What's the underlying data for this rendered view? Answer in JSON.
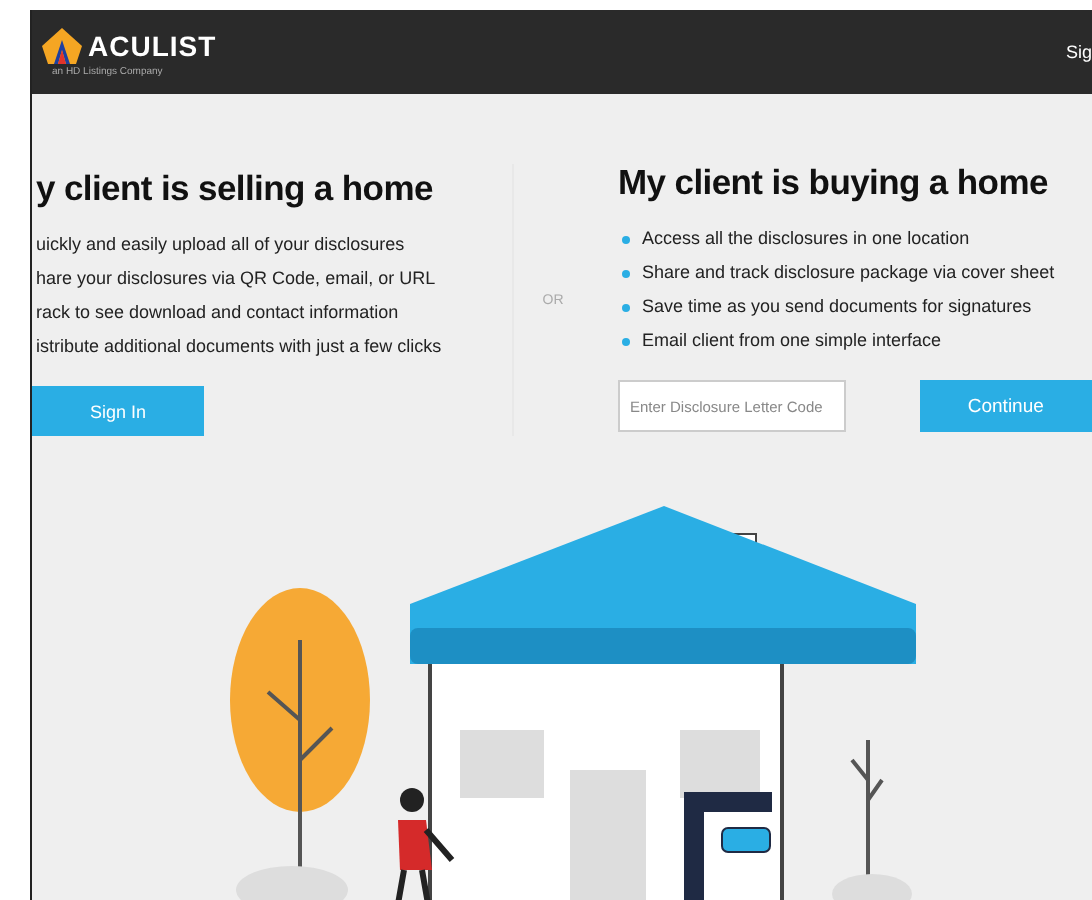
{
  "header": {
    "logo_text": "ACULIST",
    "tagline": "an HD Listings Company",
    "nav_link": "Sig"
  },
  "selling": {
    "title": "y client is selling a home",
    "bullets": [
      "uickly and easily upload all of your disclosures",
      "hare your disclosures via QR Code, email, or URL",
      "rack to see download and contact information",
      "istribute additional documents with just a few clicks"
    ],
    "button": "Sign In"
  },
  "divider": "OR",
  "buying": {
    "title": "My client is buying a home",
    "bullets": [
      "Access all the disclosures in one location",
      "Share and track disclosure package via cover sheet",
      "Save time as you send documents for signatures",
      "Email client from one simple interface"
    ],
    "code_field": {
      "placeholder": "Enter Disclosure Letter Code"
    },
    "button": "Continue"
  }
}
